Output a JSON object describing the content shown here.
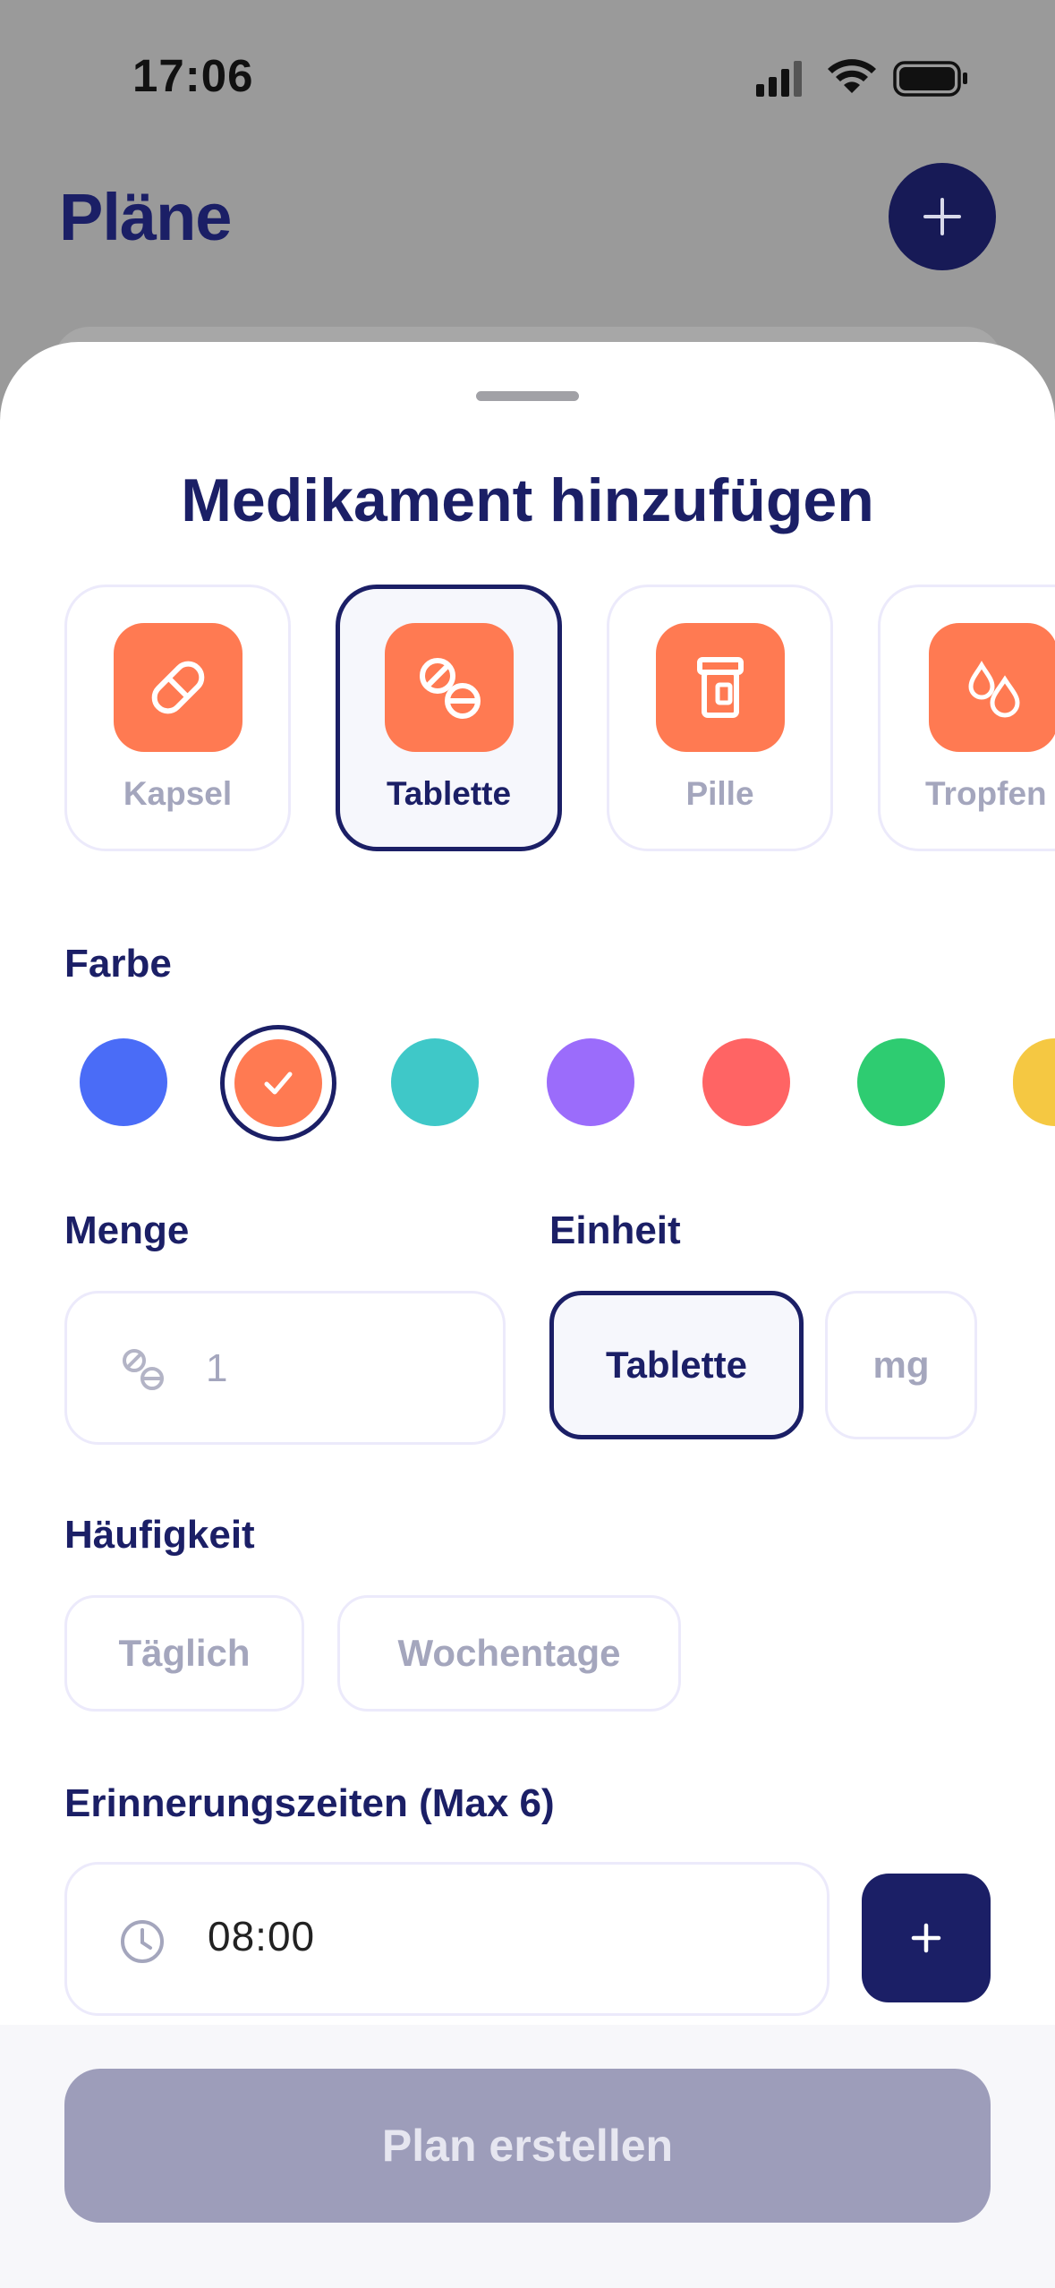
{
  "status_bar": {
    "time": "17:06"
  },
  "background": {
    "title": "Pläne"
  },
  "sheet": {
    "title": "Medikament hinzufügen",
    "types": [
      {
        "label": "Kapsel",
        "icon": "capsule-icon",
        "selected": false
      },
      {
        "label": "Tablette",
        "icon": "tablet-icon",
        "selected": true
      },
      {
        "label": "Pille",
        "icon": "pill-bottle-icon",
        "selected": false
      },
      {
        "label": "Tropfen",
        "icon": "drops-icon",
        "selected": false
      }
    ],
    "color_label": "Farbe",
    "colors": [
      "#4a6cf7",
      "#ff7a52",
      "#3fc8c8",
      "#9b6cfb",
      "#ff6464",
      "#2ecc71",
      "#f5c842"
    ],
    "selected_color_index": 1,
    "amount_label": "Menge",
    "amount_value": "1",
    "unit_label": "Einheit",
    "units": [
      {
        "label": "Tablette",
        "selected": true
      },
      {
        "label": "mg",
        "selected": false
      }
    ],
    "frequency_label": "Häufigkeit",
    "frequencies": [
      "Täglich",
      "Wochentage"
    ],
    "reminder_label": "Erinnerungszeiten (Max 6)",
    "reminder_time": "08:00",
    "create_button": "Plan erstellen"
  },
  "accent_color": "#1b1f66",
  "icon_color": "#ff7a52"
}
